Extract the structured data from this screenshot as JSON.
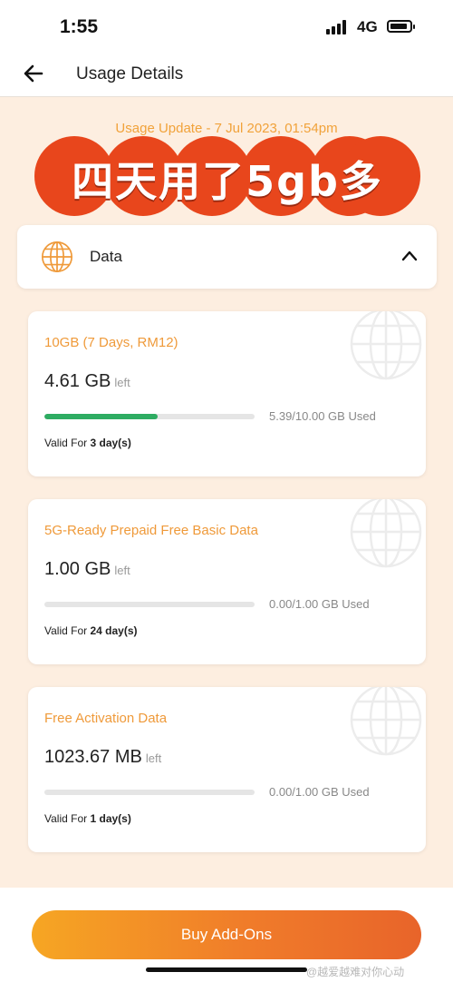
{
  "status_bar": {
    "time": "1:55",
    "network": "4G",
    "icons": [
      "signal-icon",
      "battery-icon"
    ]
  },
  "header": {
    "title": "Usage Details",
    "back_icon": "arrow-left-icon"
  },
  "update_text": "Usage Update - 7 Jul 2023, 01:54pm",
  "promo_text": "四天用了5gb多",
  "data_section": {
    "label": "Data",
    "icon": "globe-icon",
    "toggle_icon": "chevron-up-icon"
  },
  "plans": [
    {
      "name": "10GB (7 Days, RM12)",
      "remaining_value": "4.61 GB",
      "remaining_suffix": "left",
      "used_text": "5.39/10.00 GB Used",
      "used_fraction": 0.539,
      "valid_prefix": "Valid For",
      "valid_days": "3 day(s)"
    },
    {
      "name": "5G-Ready Prepaid Free Basic Data",
      "remaining_value": "1.00 GB",
      "remaining_suffix": "left",
      "used_text": "0.00/1.00 GB Used",
      "used_fraction": 0,
      "valid_prefix": "Valid For",
      "valid_days": "24 day(s)"
    },
    {
      "name": "Free Activation Data",
      "remaining_value": "1023.67 MB",
      "remaining_suffix": "left",
      "used_text": "0.00/1.00 GB Used",
      "used_fraction": 0,
      "valid_prefix": "Valid For",
      "valid_days": "1 day(s)"
    }
  ],
  "buy_button": "Buy Add-Ons",
  "watermark": "@越爱越难对你心动",
  "colors": {
    "accent_orange": "#ef9a3a",
    "progress_green": "#2eac62",
    "banner_red": "#e8461c",
    "page_background": "#fdeee0"
  }
}
